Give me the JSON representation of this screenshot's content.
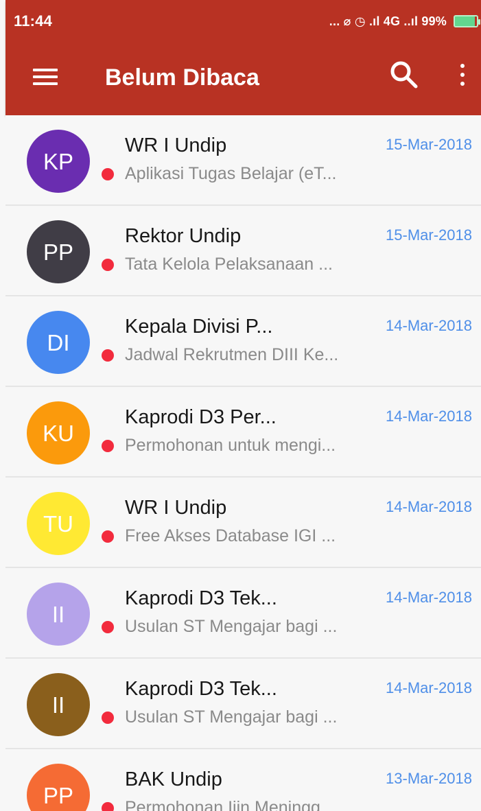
{
  "statusbar": {
    "time": "11:44",
    "icons_text": "... ⌀ ◷ .ıl 4G ..ıl 99%"
  },
  "header": {
    "title": "Belum Dibaca"
  },
  "colors": {
    "appbar": "#b83223",
    "date": "#4f8fe8",
    "unread_dot": "#f22b3d"
  },
  "messages": [
    {
      "initials": "KP",
      "sender": "WR I Undip",
      "subject": "Aplikasi Tugas Belajar (eT...",
      "date": "15-Mar-2018",
      "color": "#6a2db0"
    },
    {
      "initials": "PP",
      "sender": "Rektor Undip",
      "subject": "Tata Kelola Pelaksanaan ...",
      "date": "15-Mar-2018",
      "color": "#403d46"
    },
    {
      "initials": "DI",
      "sender": "Kepala Divisi P...",
      "subject": "Jadwal Rekrutmen DIII Ke...",
      "date": "14-Mar-2018",
      "color": "#4788ef"
    },
    {
      "initials": "KU",
      "sender": "Kaprodi D3 Per...",
      "subject": "Permohonan untuk mengi...",
      "date": "14-Mar-2018",
      "color": "#fb9a0c"
    },
    {
      "initials": "TU",
      "sender": "WR I Undip",
      "subject": "Free Akses Database IGI ...",
      "date": "14-Mar-2018",
      "color": "#ffe933"
    },
    {
      "initials": "II",
      "sender": "Kaprodi D3 Tek...",
      "subject": "Usulan ST Mengajar bagi ...",
      "date": "14-Mar-2018",
      "color": "#b5a3ea"
    },
    {
      "initials": "II",
      "sender": "Kaprodi D3 Tek...",
      "subject": "Usulan ST Mengajar bagi ...",
      "date": "14-Mar-2018",
      "color": "#8a5f1c"
    },
    {
      "initials": "PP",
      "sender": "BAK  Undip",
      "subject": "Permohonan Ijin Meningg...",
      "date": "13-Mar-2018",
      "color": "#f56b34"
    }
  ]
}
